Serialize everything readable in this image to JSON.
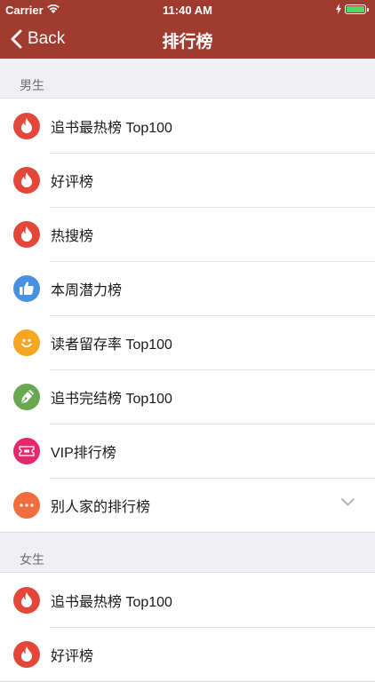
{
  "status_bar": {
    "carrier": "Carrier",
    "time": "11:40 AM"
  },
  "nav": {
    "back_label": "Back",
    "title": "排行榜"
  },
  "colors": {
    "nav_bar": "#a03b30",
    "fire_red": "#e2473a",
    "thumb_blue": "#4a90e2",
    "smile_orange": "#f5a623",
    "pen_green": "#6aa84f",
    "vip_pink": "#e4286b",
    "more_orange": "#f06d3d"
  },
  "sections": [
    {
      "header": "男生",
      "items": [
        {
          "label": "追书最热榜 Top100",
          "icon": "flame-icon"
        },
        {
          "label": "好评榜",
          "icon": "flame-icon"
        },
        {
          "label": "热搜榜",
          "icon": "flame-icon"
        },
        {
          "label": "本周潜力榜",
          "icon": "thumbs-up-icon"
        },
        {
          "label": "读者留存率 Top100",
          "icon": "smile-icon"
        },
        {
          "label": "追书完结榜 Top100",
          "icon": "pen-icon"
        },
        {
          "label": "VIP排行榜",
          "icon": "ticket-icon"
        },
        {
          "label": "别人家的排行榜",
          "icon": "more-icon",
          "expandable": true
        }
      ]
    },
    {
      "header": "女生",
      "items": [
        {
          "label": "追书最热榜 Top100",
          "icon": "flame-icon"
        },
        {
          "label": "好评榜",
          "icon": "flame-icon"
        }
      ]
    }
  ]
}
